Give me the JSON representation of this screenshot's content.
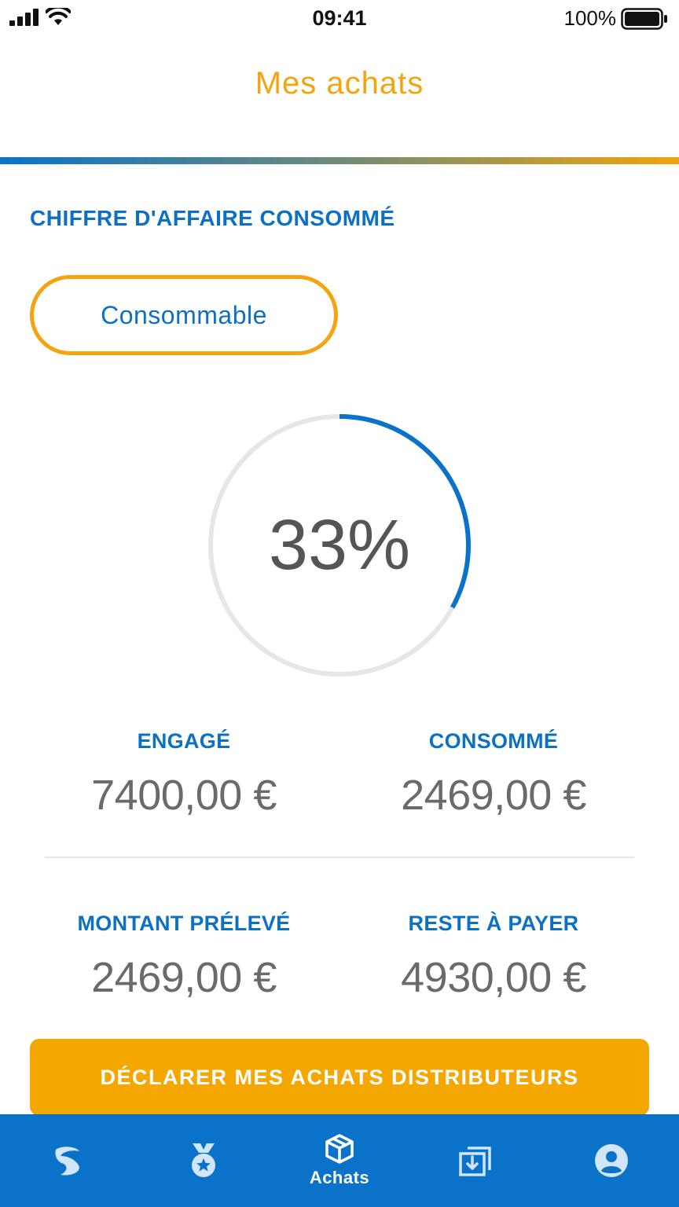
{
  "status_bar": {
    "time": "09:41",
    "battery_percent": "100%",
    "icons": [
      "signal-icon",
      "wifi-icon",
      "battery-icon"
    ]
  },
  "header": {
    "title": "Mes achats"
  },
  "section": {
    "title": "CHIFFRE D'AFFAIRE CONSOMMÉ",
    "filter_label": "Consommable"
  },
  "gauge": {
    "label": "33%",
    "value": 0.33
  },
  "stats": {
    "engage": {
      "label": "ENGAGÉ",
      "value": "7400,00 €"
    },
    "consomme": {
      "label": "CONSOMMÉ",
      "value": "2469,00 €"
    },
    "preleve": {
      "label": "MONTANT PRÉLEVÉ",
      "value": "2469,00 €"
    },
    "reste": {
      "label": "RESTE À PAYER",
      "value": "4930,00 €"
    }
  },
  "cta": {
    "label": "DÉCLARER MES ACHATS DISTRIBUTEURS"
  },
  "tabbar": {
    "items": [
      {
        "icon": "brand-logo-icon",
        "label": ""
      },
      {
        "icon": "medal-icon",
        "label": ""
      },
      {
        "icon": "package-icon",
        "label": "Achats",
        "active": true
      },
      {
        "icon": "import-icon",
        "label": ""
      },
      {
        "icon": "account-icon",
        "label": ""
      }
    ]
  },
  "colors": {
    "primary_blue": "#0a73c9",
    "accent_orange": "#f4a40f",
    "gauge_track": "#e6e6e6"
  }
}
